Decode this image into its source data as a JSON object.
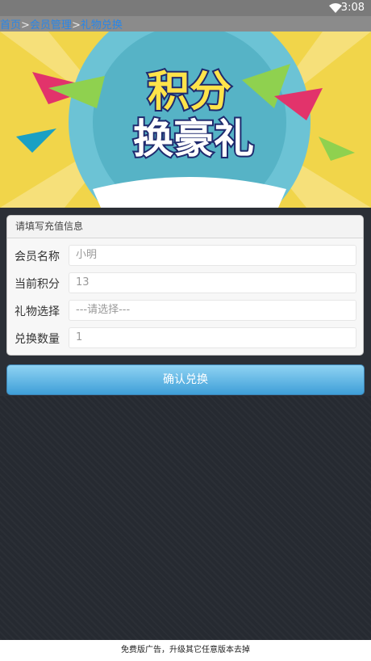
{
  "status_bar": {
    "time": "3:08"
  },
  "breadcrumb": [
    {
      "label": "首页",
      "link": true
    },
    {
      "label": ">",
      "link": false
    },
    {
      "label": "会员管理",
      "link": true
    },
    {
      "label": ">",
      "link": false
    },
    {
      "label": "礼物兑换",
      "link": true
    }
  ],
  "banner": {
    "line1": "积分",
    "line2": "换豪礼"
  },
  "panel": {
    "title": "请填写充值信息",
    "rows": [
      {
        "label": "会员名称",
        "value": "小明"
      },
      {
        "label": "当前积分",
        "value": "13"
      },
      {
        "label": "礼物选择",
        "value": "---请选择---"
      },
      {
        "label": "兑换数量",
        "value": "1"
      }
    ]
  },
  "confirm_label": "确认兑换",
  "ad_text": "免费版广告，升级其它任意版本去掉",
  "colors": {
    "accent": "#3f9fd8",
    "link": "#2a86e6",
    "banner_bg": "#f1d54a"
  }
}
